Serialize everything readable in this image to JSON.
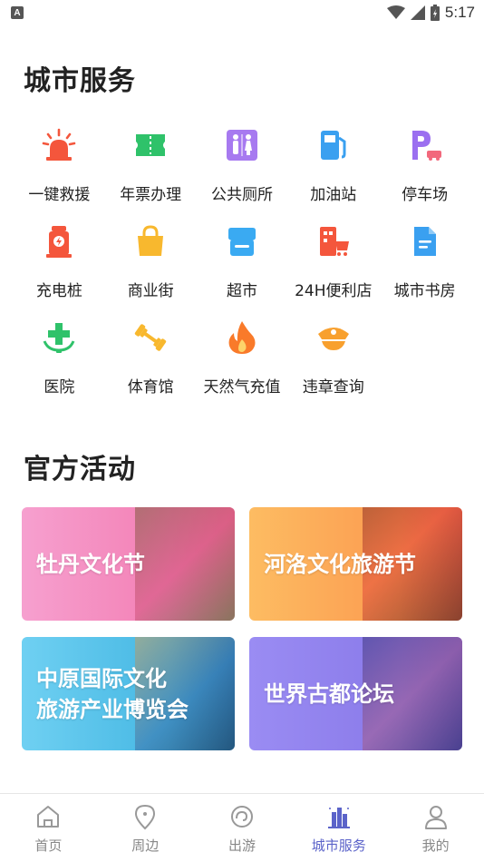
{
  "status_bar": {
    "time": "5:17"
  },
  "services": {
    "title": "城市服务",
    "items": [
      {
        "label": "一键救援",
        "icon": "siren-icon",
        "color": "#f4563c"
      },
      {
        "label": "年票办理",
        "icon": "ticket-icon",
        "color": "#2fc26a"
      },
      {
        "label": "公共厕所",
        "icon": "restroom-icon",
        "color": "#a77af0"
      },
      {
        "label": "加油站",
        "icon": "gas-station-icon",
        "color": "#3aa0f0"
      },
      {
        "label": "停车场",
        "icon": "parking-icon",
        "color": "#9b6ff0"
      },
      {
        "label": "充电桩",
        "icon": "charging-pile-icon",
        "color": "#f4563c"
      },
      {
        "label": "商业街",
        "icon": "shopping-bag-icon",
        "color": "#f8b82e"
      },
      {
        "label": "超市",
        "icon": "supermarket-icon",
        "color": "#3aaaf2"
      },
      {
        "label": "24H便利店",
        "icon": "convenience-store-icon",
        "color": "#f4563c"
      },
      {
        "label": "城市书房",
        "icon": "document-icon",
        "color": "#3aa0f0"
      },
      {
        "label": "医院",
        "icon": "hospital-icon",
        "color": "#2fc26a"
      },
      {
        "label": "体育馆",
        "icon": "dumbbell-icon",
        "color": "#f8b82e"
      },
      {
        "label": "天然气充值",
        "icon": "flame-icon",
        "color": "#f97a2a"
      },
      {
        "label": "违章查询",
        "icon": "police-cap-icon",
        "color": "#f8a02e"
      }
    ]
  },
  "activities": {
    "title": "官方活动",
    "cards": [
      {
        "lines": [
          "牡丹文化节"
        ]
      },
      {
        "lines": [
          "河洛文化旅游节"
        ]
      },
      {
        "lines": [
          "中原国际文化",
          "旅游产业博览会"
        ]
      },
      {
        "lines": [
          "世界古都论坛"
        ]
      }
    ]
  },
  "bottom_nav": {
    "active_color": "#5b63c9",
    "items": [
      {
        "label": "首页",
        "icon": "home-icon"
      },
      {
        "label": "周边",
        "icon": "location-pin-icon"
      },
      {
        "label": "出游",
        "icon": "travel-icon"
      },
      {
        "label": "城市服务",
        "icon": "city-buildings-icon",
        "active": true
      },
      {
        "label": "我的",
        "icon": "user-icon"
      }
    ]
  }
}
